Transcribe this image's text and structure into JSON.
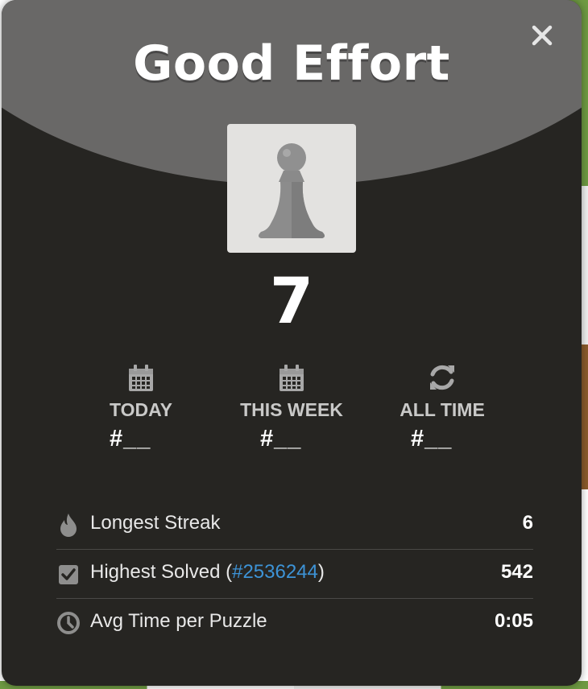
{
  "modal": {
    "title": "Good Effort",
    "score": "7",
    "close_icon": "close-icon",
    "pawn_icon": "pawn-icon"
  },
  "ranks": [
    {
      "label": "TODAY",
      "value": "#__",
      "icon": "calendar-icon"
    },
    {
      "label": "THIS WEEK",
      "value": "#__",
      "icon": "calendar-icon"
    },
    {
      "label": "ALL TIME",
      "value": "#__",
      "icon": "refresh-icon"
    }
  ],
  "stats": {
    "longest_streak": {
      "label": "Longest Streak",
      "value": "6",
      "icon": "flame-icon"
    },
    "highest_solved": {
      "label_prefix": "Highest Solved (",
      "link": "#2536244",
      "label_suffix": ")",
      "value": "542",
      "icon": "checkbox-icon"
    },
    "avg_time": {
      "label": "Avg Time per Puzzle",
      "value": "0:05",
      "icon": "clock-icon"
    }
  },
  "colors": {
    "modal_bg": "#262522",
    "header_bg": "#696867",
    "link": "#3d93d6"
  }
}
